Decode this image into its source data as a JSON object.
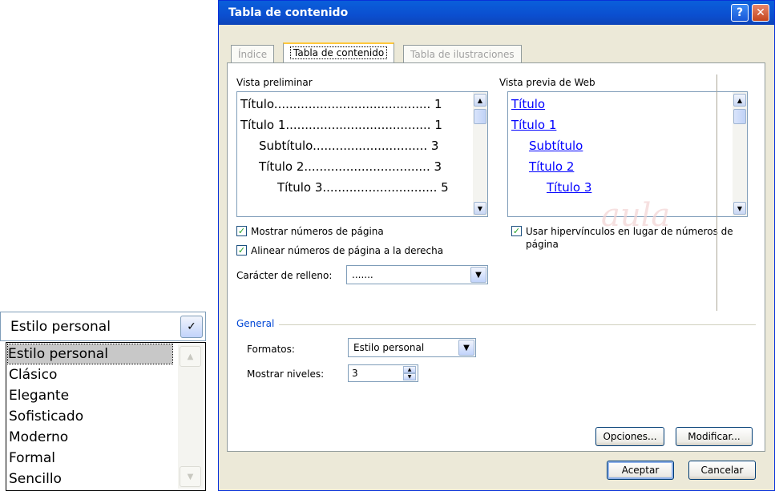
{
  "combo_popout": {
    "closed_value": "Estilo personal",
    "items": [
      "Estilo personal",
      "Clásico",
      "Elegante",
      "Sofisticado",
      "Moderno",
      "Formal",
      "Sencillo"
    ],
    "selected_index": 0
  },
  "dialog": {
    "title": "Tabla de contenido",
    "help_label": "?",
    "close_label": "✕",
    "tabs": [
      {
        "label": "Índice",
        "active": false
      },
      {
        "label": "Tabla de contenido",
        "active": true
      },
      {
        "label": "Tabla de ilustraciones",
        "active": false
      }
    ],
    "print_preview": {
      "label": "Vista preliminar",
      "lines": [
        {
          "text": "Título......................................... 1"
        },
        {
          "text": "Título 1...................................... 1"
        },
        {
          "text": "Subtítulo.............................. 3"
        },
        {
          "text": "Título 2................................. 3"
        },
        {
          "text": "Título 3.............................. 5"
        }
      ]
    },
    "web_preview": {
      "label": "Vista previa de Web",
      "links": [
        "Título",
        "Título 1",
        "Subtítulo",
        "Título 2",
        "Título 3"
      ]
    },
    "checkboxes": {
      "show_page_numbers": {
        "label": "Mostrar números de página",
        "checked": true
      },
      "align_right": {
        "label": "Alinear números de página a la derecha",
        "checked": true
      },
      "use_hyperlinks": {
        "label": "Usar hipervínculos en lugar de números de",
        "label2": "página",
        "checked": true
      }
    },
    "tab_leader": {
      "label": "Carácter de relleno:",
      "value": "......."
    },
    "watermark": "aula",
    "general": {
      "group_label": "General",
      "formats_label": "Formatos:",
      "formats_value": "Estilo personal",
      "levels_label": "Mostrar niveles:",
      "levels_value": "3"
    },
    "buttons": {
      "options": "Opciones...",
      "modify": "Modificar...",
      "ok": "Aceptar",
      "cancel": "Cancelar"
    }
  },
  "colors": {
    "title_bar": "#0b4fd0",
    "dialog_bg": "#ece9d8",
    "link": "#0000ff",
    "group_label": "#0046d5"
  }
}
